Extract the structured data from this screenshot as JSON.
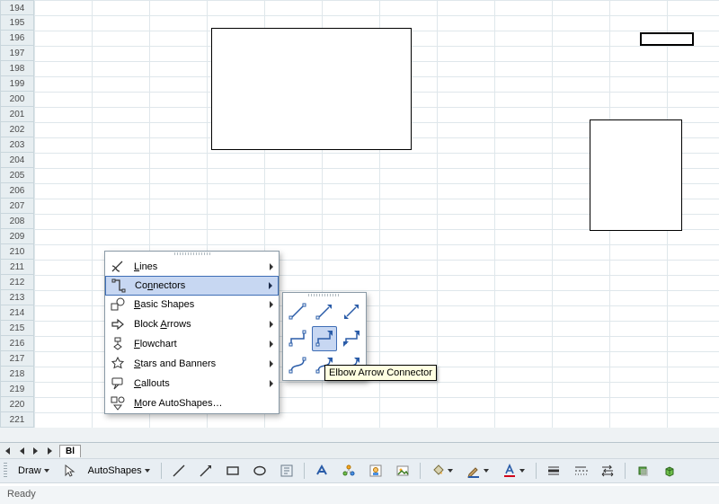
{
  "row_headers": [
    "194",
    "195",
    "196",
    "197",
    "198",
    "199",
    "200",
    "201",
    "202",
    "203",
    "204",
    "205",
    "206",
    "207",
    "208",
    "209",
    "210",
    "211",
    "212",
    "213",
    "214",
    "215",
    "216",
    "217",
    "218",
    "219",
    "220",
    "221"
  ],
  "sheet_tab": "Bl",
  "menu": {
    "items": [
      {
        "char": "L",
        "rest": "ines"
      },
      {
        "char": "N",
        "rest": "Co",
        "pre": "Co",
        "mid": "n",
        "suf": "nectors",
        "raw": "Connectors"
      },
      {
        "char": "B",
        "rest": "asic Shapes"
      },
      {
        "char": "A",
        "rest": "Block ",
        "pre": "Block ",
        "mid": "A",
        "suf": "rrows",
        "raw": "Block Arrows"
      },
      {
        "char": "F",
        "rest": "lowchart"
      },
      {
        "char": "S",
        "rest": "tars and Banners"
      },
      {
        "char": "C",
        "rest": "allouts"
      },
      {
        "char": "M",
        "rest": "ore AutoShapes…"
      }
    ]
  },
  "tooltip": "Elbow Arrow Connector",
  "toolbar": {
    "draw": "Draw",
    "autoshapes": "AutoShapes"
  },
  "status": "Ready",
  "connector_names": [
    "straight-connector",
    "straight-arrow-connector",
    "straight-double-arrow-connector",
    "elbow-connector",
    "elbow-arrow-connector",
    "elbow-double-arrow-connector",
    "curved-connector",
    "curved-arrow-connector",
    "curved-double-arrow-connector"
  ]
}
